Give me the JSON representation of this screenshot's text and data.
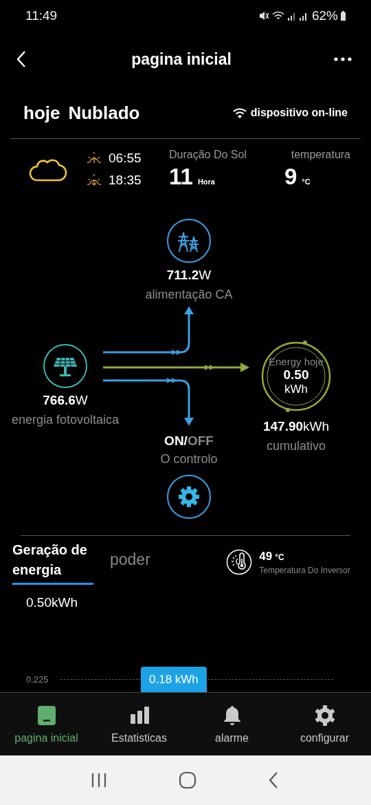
{
  "status_bar": {
    "time": "11:49",
    "battery": "62%"
  },
  "header": {
    "title": "pagina inicial"
  },
  "weather": {
    "day": "hoje",
    "condition": "Nublado",
    "device_status": "dispositivo on-line"
  },
  "sun": {
    "sunrise": "06:55",
    "sunset": "18:35",
    "duration_label": "Duração Do Sol",
    "duration_value": "11",
    "duration_unit": "Hora",
    "temperature_label": "temperatura",
    "temperature_value": "9",
    "temperature_unit": "°C"
  },
  "flow": {
    "grid": {
      "value": "711.2",
      "unit": "W",
      "label": "alimentação CA"
    },
    "pv": {
      "value": "766.6",
      "unit": "W",
      "label": "energia fotovoltaica"
    },
    "energy": {
      "title": "Energy hoje",
      "value": "0.50",
      "unit": "kWh",
      "total_value": "147.90",
      "total_unit": "kWh",
      "total_label": "cumulativo"
    },
    "control": {
      "on_label": "ON",
      "separator": "/",
      "off_label": "OFF",
      "on": true,
      "label": "O controlo"
    }
  },
  "tabs": [
    {
      "label": "Geração de energia",
      "selected": true
    },
    {
      "label": "poder",
      "selected": false
    }
  ],
  "inverter": {
    "value": "49",
    "unit": "°C",
    "label": "Temperatura Do Inversor"
  },
  "chart": {
    "total": "0.50kWh",
    "axis_label": "0.225",
    "tooltip": "0.18 kWh"
  },
  "nav": [
    {
      "label": "pagina inicial",
      "kind": "home",
      "selected": true
    },
    {
      "label": "Estatisticas",
      "kind": "stats",
      "selected": false
    },
    {
      "label": "alarme",
      "kind": "bell",
      "selected": false
    },
    {
      "label": "configurar",
      "kind": "gear",
      "selected": false
    }
  ]
}
